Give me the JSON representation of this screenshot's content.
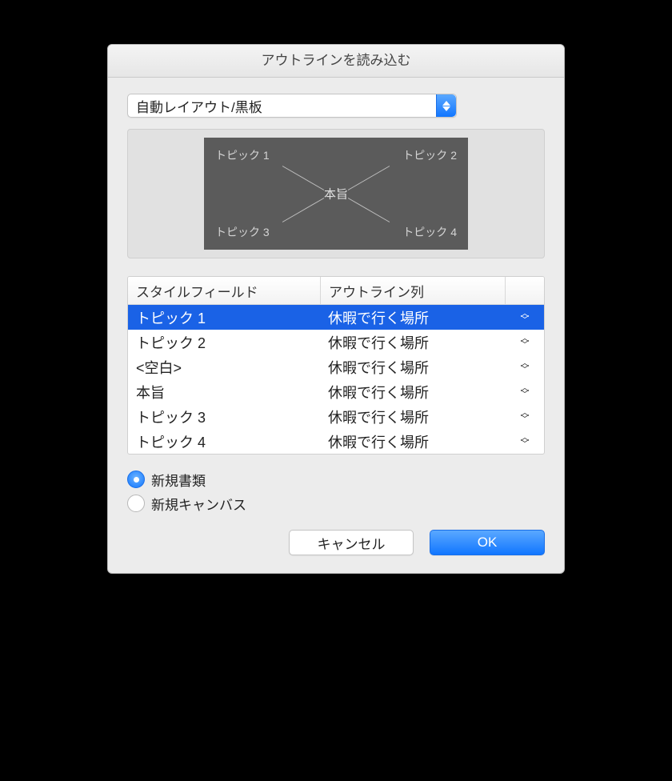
{
  "dialog": {
    "title": "アウトラインを読み込む"
  },
  "dropdown": {
    "selected": "自動レイアウト/黒板"
  },
  "preview": {
    "center": "本旨",
    "topics": {
      "tl": "トピック 1",
      "tr": "トピック 2",
      "bl": "トピック 3",
      "br": "トピック 4"
    }
  },
  "table": {
    "headers": {
      "style_field": "スタイルフィールド",
      "outline_col": "アウトライン列"
    },
    "rows": [
      {
        "style": "トピック 1",
        "outline": "休暇で行く場所",
        "selected": true
      },
      {
        "style": "トピック 2",
        "outline": "休暇で行く場所",
        "selected": false
      },
      {
        "style": "<空白>",
        "outline": "休暇で行く場所",
        "selected": false
      },
      {
        "style": "本旨",
        "outline": "休暇で行く場所",
        "selected": false
      },
      {
        "style": "トピック 3",
        "outline": "休暇で行く場所",
        "selected": false
      },
      {
        "style": "トピック 4",
        "outline": "休暇で行く場所",
        "selected": false
      }
    ]
  },
  "radios": {
    "new_document": "新規書類",
    "new_canvas": "新規キャンバス",
    "selected": "new_document"
  },
  "buttons": {
    "cancel": "キャンセル",
    "ok": "OK"
  }
}
